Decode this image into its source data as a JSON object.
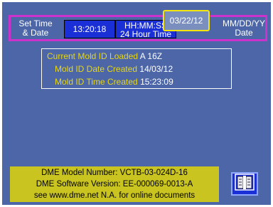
{
  "header": {
    "set_label_line1": "Set Time",
    "set_label_line2": "& Date",
    "time_value": "13:20:18",
    "time_format_line1": "HH:MM:SS",
    "time_format_line2": "24 Hour Time",
    "date_value": "03/22/12",
    "date_format_line1": "MM/DD/YY",
    "date_format_line2": "Date"
  },
  "mold_info": {
    "current_label": "Current Mold ID Loaded",
    "current_value": "A 16Z",
    "date_label": "Mold ID Date Created",
    "date_value": "14/03/12",
    "time_label": "Mold ID Time Created",
    "time_value": "15:23:09"
  },
  "footer": {
    "line1": "DME Model Number:  VCTB-03-024D-16",
    "line2": "DME Software Version: EE-000069-0013-A",
    "line3": "see www.dme.net N.A. for online documents"
  },
  "icons": {
    "exit": "door-exit-icon"
  },
  "colors": {
    "screen_bg": "#4c66a8",
    "value_box": "#1b2fd6",
    "highlight": "#f5e60e",
    "frame": "#cc33cc",
    "label_yellow": "#e6d61a",
    "footer_bg": "#c9c41f"
  }
}
